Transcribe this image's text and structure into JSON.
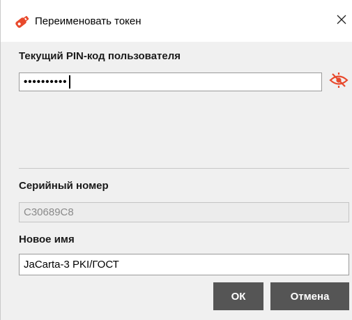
{
  "dialog": {
    "title": "Переименовать токен",
    "close_glyph": "✕"
  },
  "pin": {
    "label": "Текущий PIN-код пользователя",
    "value": "••••••••••",
    "toggle_icon": "eye-crossed-icon"
  },
  "serial": {
    "label": "Серийный номер",
    "value": "C30689C8"
  },
  "new_name": {
    "label": "Новое имя",
    "value": "JaCarta-3 PKI/ГОСТ"
  },
  "buttons": {
    "ok": "ОК",
    "cancel": "Отмена"
  },
  "colors": {
    "accent": "#e8492c",
    "button_bg": "#555555"
  }
}
